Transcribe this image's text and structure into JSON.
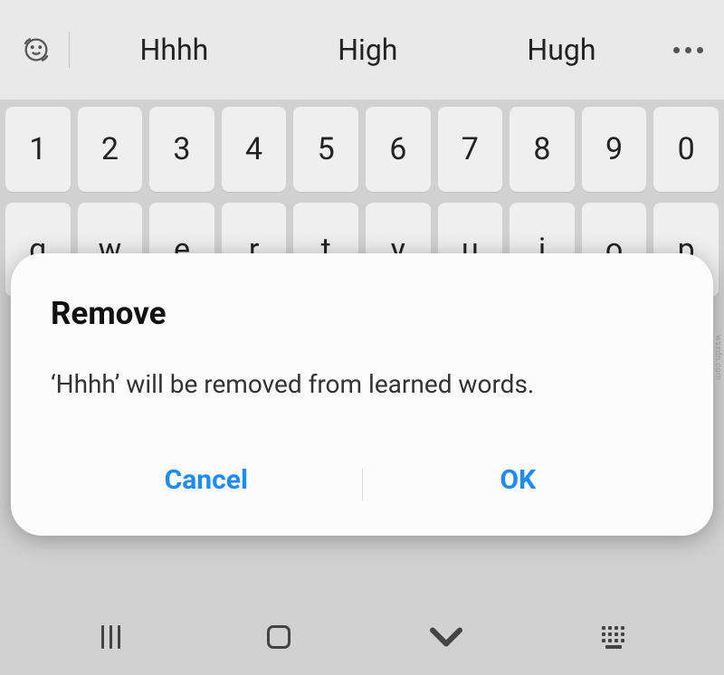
{
  "suggestionBar": {
    "items": [
      "Hhhh",
      "High",
      "Hugh"
    ]
  },
  "keyboard": {
    "row1": [
      "1",
      "2",
      "3",
      "4",
      "5",
      "6",
      "7",
      "8",
      "9",
      "0"
    ],
    "row2": [
      "q",
      "w",
      "e",
      "r",
      "t",
      "y",
      "u",
      "i",
      "o",
      "p"
    ]
  },
  "dialog": {
    "title": "Remove",
    "message": "‘Hhhh’ will be removed from learned words.",
    "cancel": "Cancel",
    "ok": "OK"
  },
  "watermark": "wsxdn.com",
  "colors": {
    "accent": "#1a8cff"
  }
}
